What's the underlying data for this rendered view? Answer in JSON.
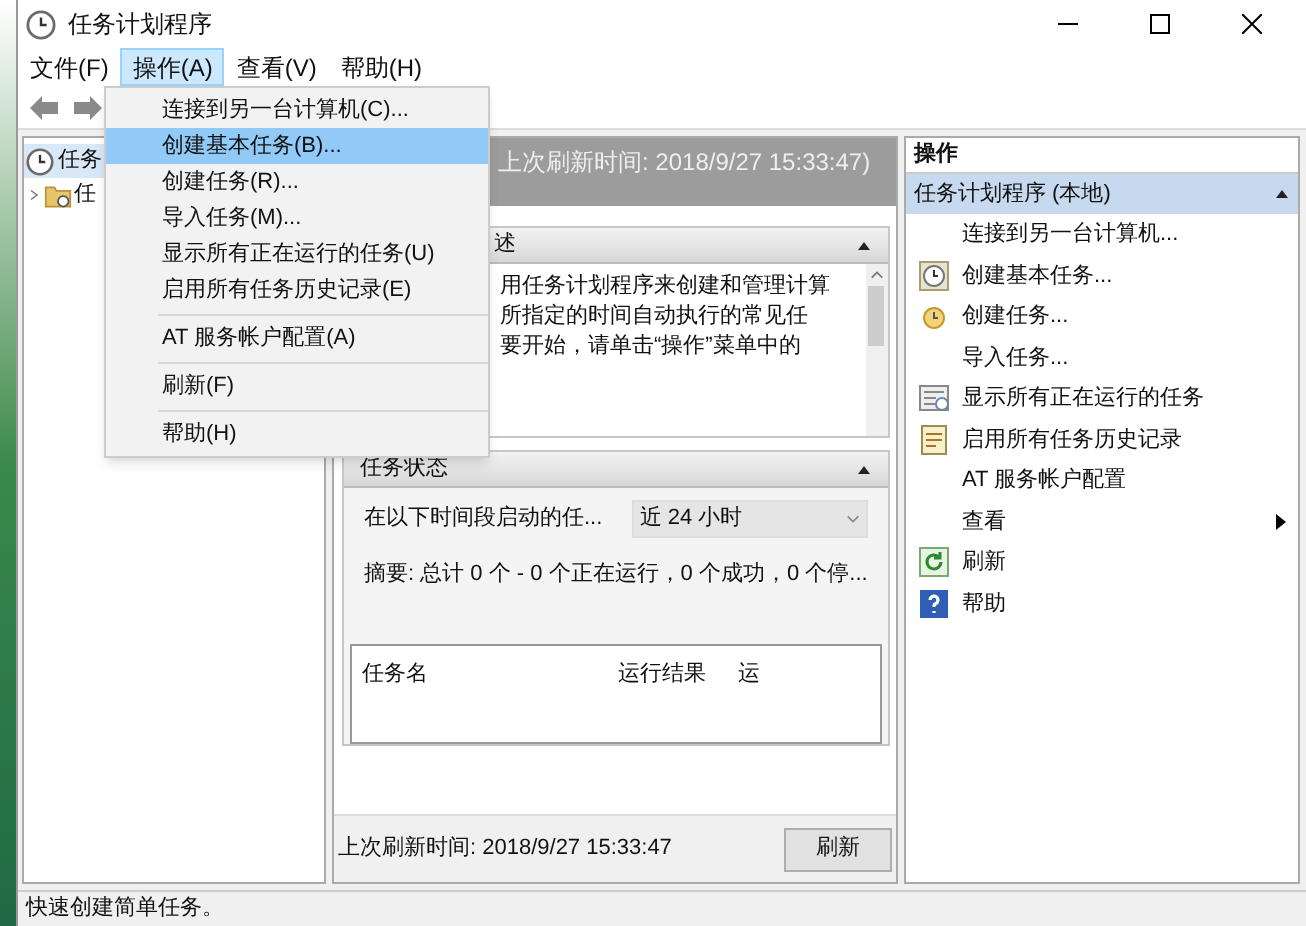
{
  "window": {
    "title": "任务计划程序"
  },
  "menu_bar": [
    {
      "label": "文件(F)",
      "selected": false
    },
    {
      "label": "操作(A)",
      "selected": true
    },
    {
      "label": "查看(V)",
      "selected": false
    },
    {
      "label": "帮助(H)",
      "selected": false
    }
  ],
  "dropdown_menu": [
    {
      "kind": "item",
      "label": "连接到另一台计算机(C)...",
      "selected": false
    },
    {
      "kind": "item",
      "label": "创建基本任务(B)...",
      "selected": true
    },
    {
      "kind": "item",
      "label": "创建任务(R)...",
      "selected": false
    },
    {
      "kind": "item",
      "label": "导入任务(M)...",
      "selected": false
    },
    {
      "kind": "item",
      "label": "显示所有正在运行的任务(U)",
      "selected": false
    },
    {
      "kind": "item",
      "label": "启用所有任务历史记录(E)",
      "selected": false
    },
    {
      "kind": "separator"
    },
    {
      "kind": "item",
      "label": "AT 服务帐户配置(A)",
      "selected": false
    },
    {
      "kind": "separator"
    },
    {
      "kind": "item",
      "label": "刷新(F)",
      "selected": false
    },
    {
      "kind": "separator"
    },
    {
      "kind": "item",
      "label": "帮助(H)",
      "selected": false
    }
  ],
  "tree": [
    {
      "label": "任务",
      "selected": true,
      "children": [
        {
          "label": "任",
          "selected": false,
          "expanded": false
        }
      ]
    }
  ],
  "main": {
    "header": "上次刷新时间: 2018/9/27 15:33:47)",
    "overview": {
      "title": "述",
      "lines": [
        "用任务计划程序来创建和管理计算",
        "所指定的时间自动执行的常见任",
        "要开始，请单击“操作”菜单中的"
      ]
    },
    "status": {
      "title": "任务状态",
      "period_label": "在以下时间段启动的任...",
      "period_value": "近 24 小时",
      "summary": "摘要: 总计 0 个 - 0 个正在运行，0 个成功，0 个停...",
      "columns": [
        "任务名",
        "运行结果",
        "运"
      ]
    },
    "footer": {
      "refreshed": "上次刷新时间: 2018/9/27 15:33:47",
      "button": "刷新"
    }
  },
  "actions": {
    "title": "操作",
    "group": "任务计划程序 (本地)",
    "items": [
      {
        "kind": "none",
        "label": "连接到另一台计算机..."
      },
      {
        "kind": "clock",
        "label": "创建基本任务..."
      },
      {
        "kind": "task",
        "label": "创建任务..."
      },
      {
        "kind": "none",
        "label": "导入任务..."
      },
      {
        "kind": "running",
        "label": "显示所有正在运行的任务"
      },
      {
        "kind": "history",
        "label": "启用所有任务历史记录"
      },
      {
        "kind": "none",
        "label": "AT 服务帐户配置"
      },
      {
        "kind": "submenu",
        "label": "查看"
      },
      {
        "kind": "refresh",
        "label": "刷新"
      },
      {
        "kind": "help",
        "label": "帮助"
      }
    ]
  },
  "status_bar": "快速创建简单任务。"
}
